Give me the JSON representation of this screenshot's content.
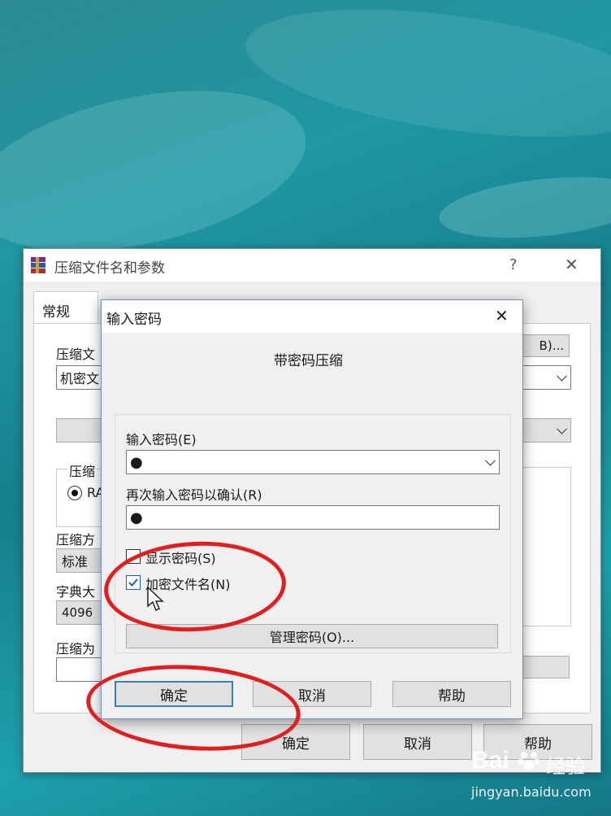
{
  "back_dialog": {
    "title": "压缩文件名和参数",
    "help_glyph": "?",
    "close_glyph": "✕",
    "tab_general": "常规",
    "archive_name_label": "压缩文",
    "archive_name_value": "机密文",
    "browse_button_partial": "B)...",
    "format_group_label": "压缩",
    "format_option_partial": "RA",
    "method_label": "压缩方",
    "method_value": "标准",
    "dict_label": "字典大",
    "dict_value": "4096",
    "split_label": "压缩为",
    "ok_button": "确定",
    "cancel_button": "取消",
    "help_button": "帮助"
  },
  "password_dialog": {
    "title": "输入密码",
    "close_glyph": "✕",
    "heading": "带密码压缩",
    "enter_password_label": "输入密码(E)",
    "enter_password_value": "●",
    "reenter_password_label": "再次输入密码以确认(R)",
    "reenter_password_value": "●",
    "show_password_label": "显示密码(S)",
    "show_password_checked": false,
    "encrypt_filenames_label": "加密文件名(N)",
    "encrypt_filenames_checked": true,
    "organize_passwords_button": "管理密码(O)...",
    "ok_button": "确定",
    "cancel_button": "取消",
    "help_button": "帮助"
  },
  "watermark": {
    "logo_text": "Bai",
    "logo_suffix": "经验",
    "url": "jingyan.baidu.com"
  },
  "colors": {
    "annotation": "#e02020",
    "focus": "#3c7fb1",
    "desktop": "#1f97a4"
  }
}
